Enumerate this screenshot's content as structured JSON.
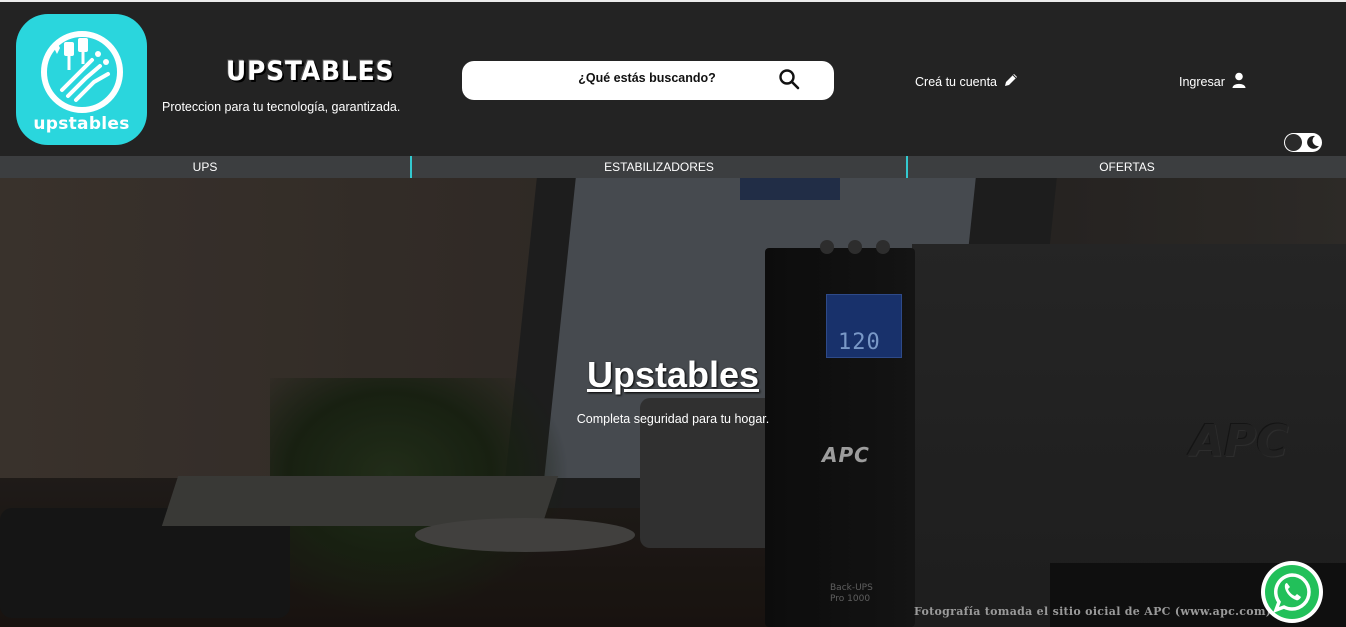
{
  "header": {
    "logo_text": "upstables",
    "brand_title": "UPSTABLES",
    "tagline": "Proteccion para tu tecnología, garantizada.",
    "search": {
      "placeholder": "¿Qué estás buscando?",
      "value": ""
    },
    "create_account": "Creá tu cuenta",
    "login": "Ingresar",
    "theme_toggle_icon": "moon-icon"
  },
  "nav": {
    "items": [
      {
        "label": "UPS"
      },
      {
        "label": "ESTABILIZADORES"
      },
      {
        "label": "OFERTAS"
      }
    ]
  },
  "hero": {
    "title": "Upstables",
    "subtitle": "Completa seguridad para tu hogar.",
    "lcd_value": "120",
    "brand_front": "APC",
    "brand_side": "APC",
    "model_line1": "Back-UPS",
    "model_line2": "Pro 1000",
    "photo_credit": "Fotografía tomada el sitio oicial de APC (www.apc.com)"
  },
  "colors": {
    "accent": "#2ad6dd",
    "header_bg": "#232323",
    "nav_bg": "#3c3e40",
    "whatsapp": "#22c05a"
  },
  "icons": {
    "search": "search-icon",
    "pencil": "pencil-icon",
    "user": "user-icon",
    "whatsapp": "whatsapp-icon"
  }
}
